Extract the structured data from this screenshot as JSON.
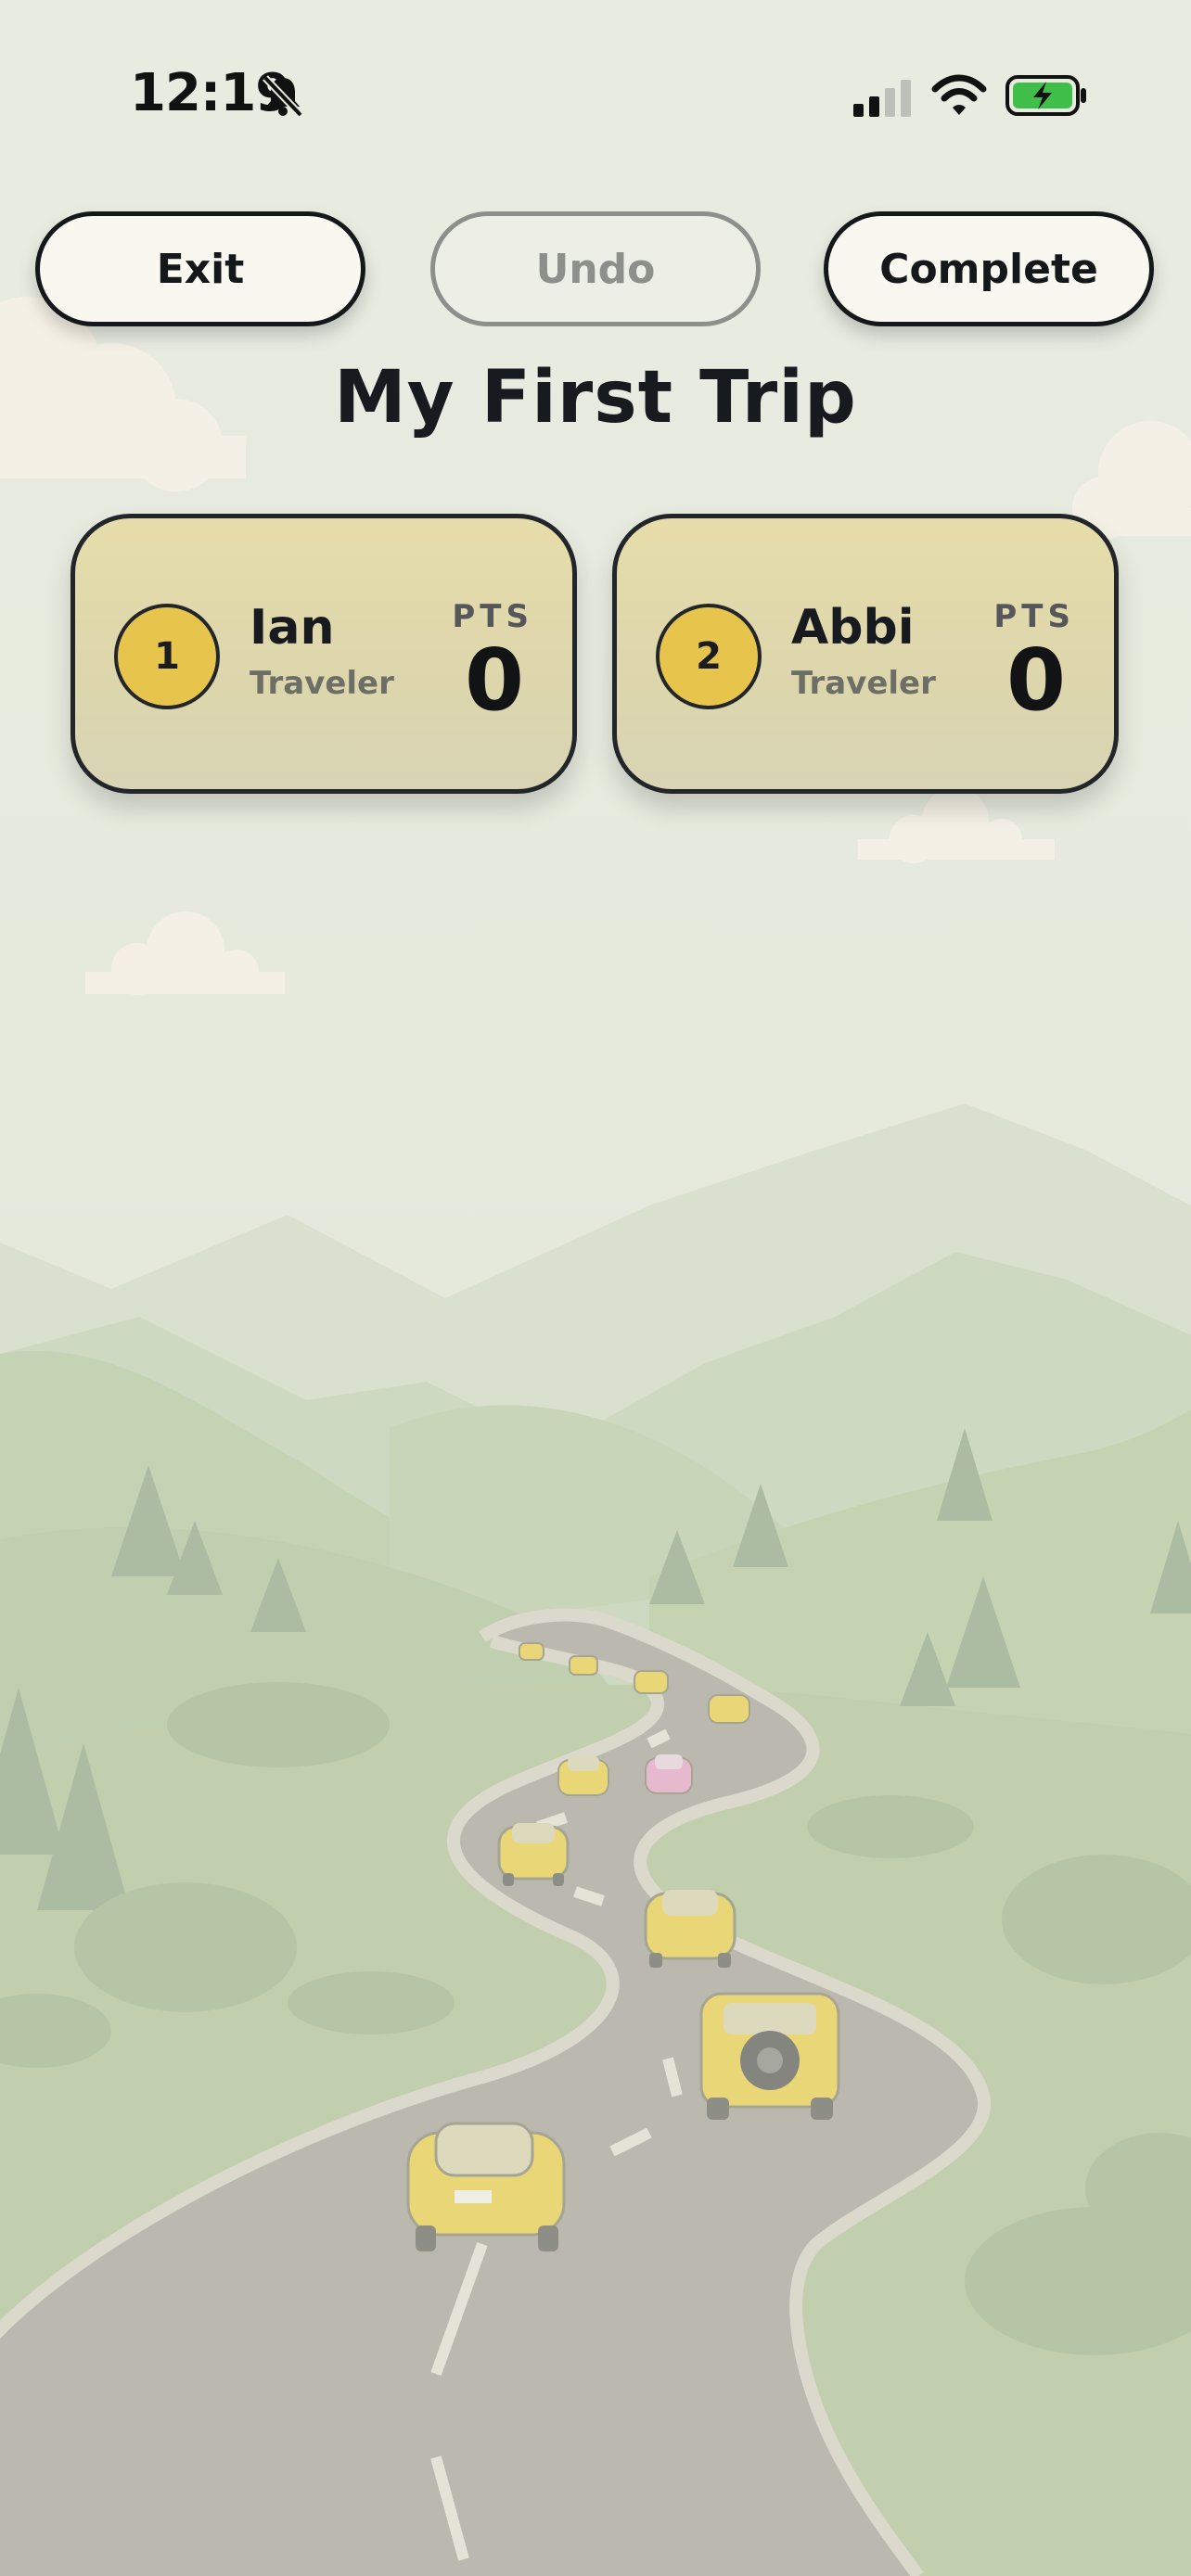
{
  "status_bar": {
    "time": "12:19",
    "icons": [
      "bell-slash-icon",
      "cellular-signal-icon",
      "wifi-icon",
      "battery-charging-icon"
    ],
    "battery_color": "#3fbf4a"
  },
  "toolbar": {
    "exit_label": "Exit",
    "undo_label": "Undo",
    "complete_label": "Complete"
  },
  "trip": {
    "title": "My First Trip"
  },
  "players": [
    {
      "rank": "1",
      "name": "Ian",
      "role": "Traveler",
      "pts_label": "PTS",
      "points": "0"
    },
    {
      "rank": "2",
      "name": "Abbi",
      "role": "Traveler",
      "pts_label": "PTS",
      "points": "0"
    }
  ],
  "theme": {
    "card_color": "#e3dcae",
    "badge_color": "#e7c54c",
    "car_color": "#e8cd4e",
    "accent_car_color": "#e7a6c6"
  }
}
